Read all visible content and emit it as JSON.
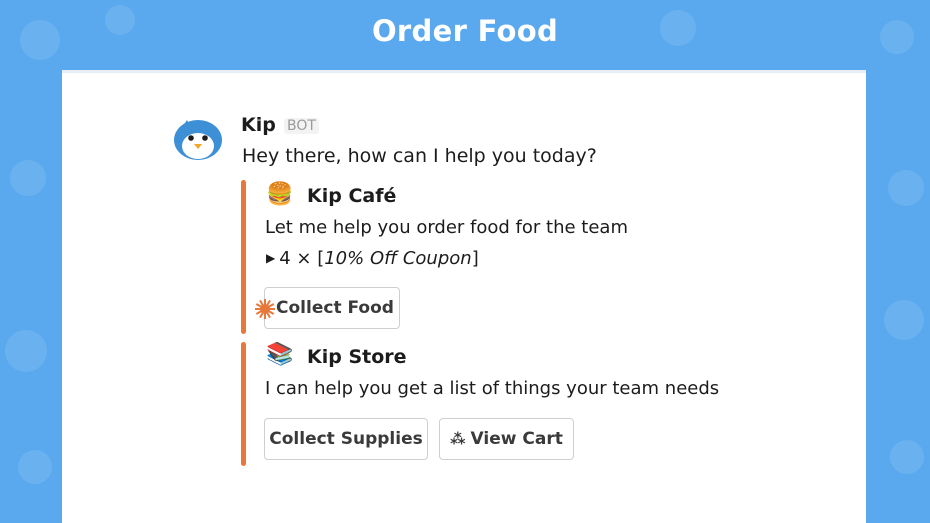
{
  "banner": {
    "title": "Order Food"
  },
  "message": {
    "sender": "Kip",
    "badge": "BOT",
    "text": "Hey there, how can I help you today?",
    "avatar_icon": "penguin-avatar-icon"
  },
  "attachments": [
    {
      "icon": "🍔",
      "icon_name": "burger-icon",
      "title": "Kip Café",
      "text": "Let me help you order food for the team",
      "coupon": {
        "prefix": "4 × [",
        "label": "10% Off Coupon",
        "suffix": "]"
      },
      "buttons": [
        {
          "label": "Collect Food",
          "icon_name": "starburst-icon"
        }
      ]
    },
    {
      "icon": "📚",
      "icon_name": "books-icon",
      "title": "Kip Store",
      "text": "I can help you get a list of things your team needs",
      "buttons": [
        {
          "label": "Collect Supplies"
        },
        {
          "label": "View Cart",
          "icon": "⁂",
          "icon_name": "cart-icon"
        }
      ]
    }
  ],
  "colors": {
    "background": "#5aa9ee",
    "accent_bar": "#e8783a",
    "card": "#ffffff",
    "text": "#1d1c1d"
  }
}
